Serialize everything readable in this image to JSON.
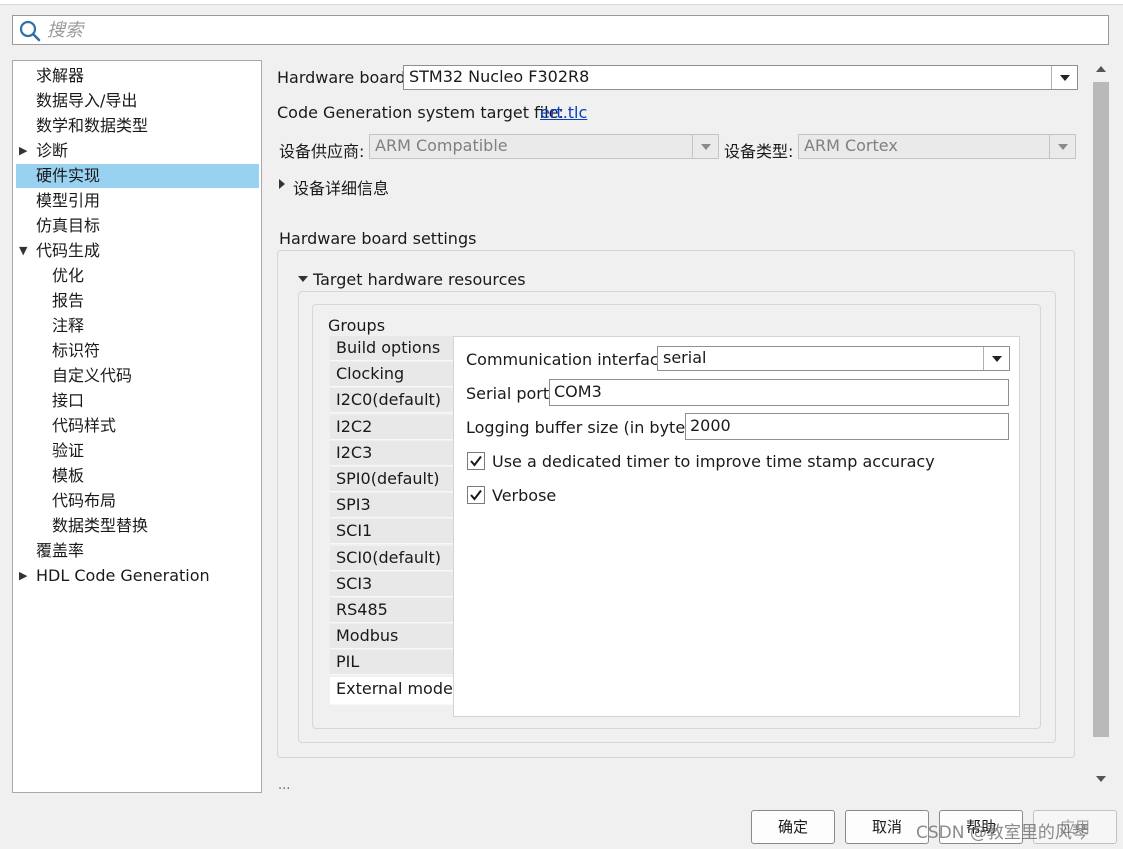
{
  "search": {
    "placeholder": "搜索",
    "icon": "search-icon"
  },
  "tree": {
    "items": [
      {
        "label": "求解器",
        "level": 0,
        "expander": ""
      },
      {
        "label": "数据导入/导出",
        "level": 0,
        "expander": ""
      },
      {
        "label": "数学和数据类型",
        "level": 0,
        "expander": ""
      },
      {
        "label": "诊断",
        "level": 0,
        "expander": "collapsed"
      },
      {
        "label": "硬件实现",
        "level": 0,
        "expander": "",
        "selected": true
      },
      {
        "label": "模型引用",
        "level": 0,
        "expander": ""
      },
      {
        "label": "仿真目标",
        "level": 0,
        "expander": ""
      },
      {
        "label": "代码生成",
        "level": 0,
        "expander": "expanded"
      },
      {
        "label": "优化",
        "level": 1,
        "expander": ""
      },
      {
        "label": "报告",
        "level": 1,
        "expander": ""
      },
      {
        "label": "注释",
        "level": 1,
        "expander": ""
      },
      {
        "label": "标识符",
        "level": 1,
        "expander": ""
      },
      {
        "label": "自定义代码",
        "level": 1,
        "expander": ""
      },
      {
        "label": "接口",
        "level": 1,
        "expander": ""
      },
      {
        "label": "代码样式",
        "level": 1,
        "expander": ""
      },
      {
        "label": "验证",
        "level": 1,
        "expander": ""
      },
      {
        "label": "模板",
        "level": 1,
        "expander": ""
      },
      {
        "label": "代码布局",
        "level": 1,
        "expander": ""
      },
      {
        "label": "数据类型替换",
        "level": 1,
        "expander": ""
      },
      {
        "label": "覆盖率",
        "level": 0,
        "expander": ""
      },
      {
        "label": "HDL Code Generation",
        "level": 0,
        "expander": "collapsed"
      }
    ],
    "selected_color": "#99d1f1"
  },
  "main": {
    "hardware_board_label": "Hardware board:",
    "hardware_board_value": "STM32 Nucleo F302R8",
    "target_file_label": "Code Generation system target file:",
    "target_file_link": "ert.tlc",
    "vendor_label": "设备供应商:",
    "vendor_value": "ARM Compatible",
    "type_label": "设备类型:",
    "type_value": "ARM Cortex",
    "device_details_label": "设备详细信息",
    "board_settings_title": "Hardware board settings",
    "target_resources_label": "Target hardware resources",
    "groups_label": "Groups",
    "groups": [
      "Build options",
      "Clocking",
      "I2C0(default)",
      "I2C2",
      "I2C3",
      "SPI0(default)",
      "SPI3",
      "SCI1",
      "SCI0(default)",
      "SCI3",
      "RS485",
      "Modbus",
      "PIL",
      "External mode"
    ],
    "active_group": "External mode",
    "comm_interface_label": "Communication interface:",
    "comm_interface_value": "serial",
    "serial_port_label": "Serial port:",
    "serial_port_value": "COM3",
    "logging_buffer_label": "Logging buffer size (in bytes):",
    "logging_buffer_value": "2000",
    "timer_checkbox_label": "Use a dedicated timer to improve time stamp accuracy",
    "timer_checkbox_checked": true,
    "verbose_label": "Verbose",
    "verbose_checked": true,
    "ellipsis": "..."
  },
  "footer": {
    "ok": "确定",
    "cancel": "取消",
    "help": "帮助",
    "apply": "应用"
  },
  "watermark": "CSDN @教室里的风琴"
}
